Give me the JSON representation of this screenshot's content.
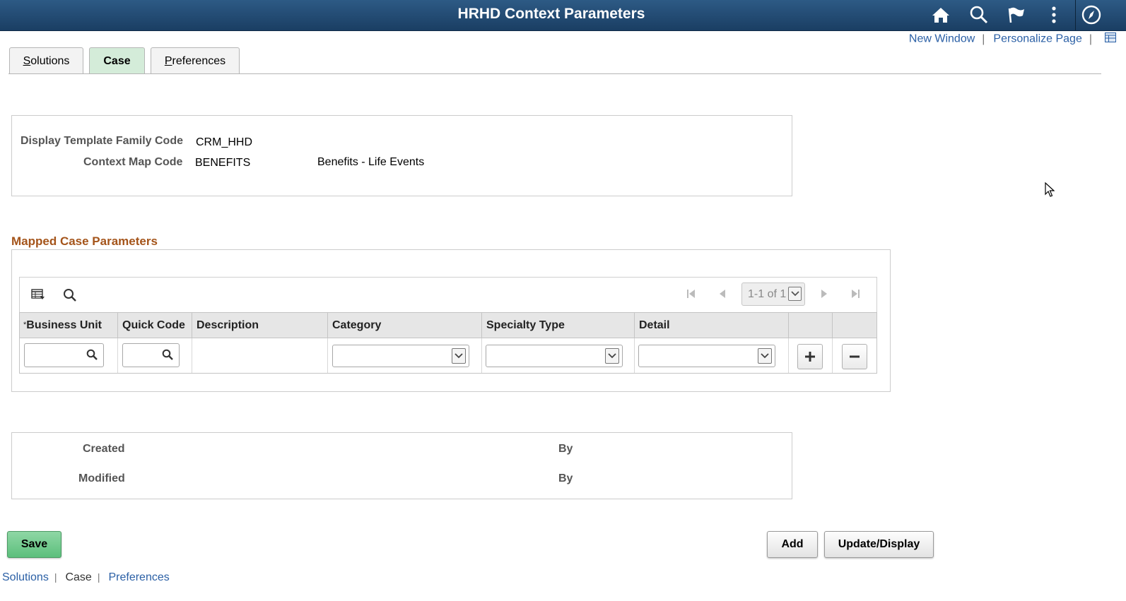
{
  "header": {
    "title": "HRHD Context Parameters",
    "icons": [
      "home-icon",
      "search-icon",
      "flag-icon",
      "more-vertical-icon",
      "navbar-compass-icon"
    ]
  },
  "toplinks": {
    "new_window": "New Window",
    "personalize_page": "Personalize Page",
    "separator": "|"
  },
  "tabs": [
    {
      "label": "Solutions",
      "access_key": "S",
      "rest": "olutions",
      "active": false
    },
    {
      "label": "Case",
      "active": true
    },
    {
      "label": "Preferences",
      "access_key": "P",
      "rest": "references",
      "active": false
    }
  ],
  "header_box": {
    "family_label": "Display Template Family Code",
    "family_value": "CRM_HHD",
    "context_label": "Context Map Code",
    "context_value": "BENEFITS",
    "context_desc": "Benefits - Life Events"
  },
  "grid": {
    "title": "Mapped Case Parameters",
    "pager": "1-1 of 1",
    "required_mark": "*",
    "columns": [
      "Business Unit",
      "Quick Code",
      "Description",
      "Category",
      "Specialty Type",
      "Detail"
    ],
    "row": {
      "business_unit": "",
      "quick_code": "",
      "description": "",
      "category": "",
      "specialty_type": "",
      "detail": ""
    }
  },
  "audit": {
    "created_label": "Created",
    "created_by_label": "By",
    "modified_label": "Modified",
    "modified_by_label": "By"
  },
  "buttons": {
    "save": "Save",
    "add": "Add",
    "update_display": "Update/Display"
  },
  "bottomlinks": {
    "solutions": "Solutions",
    "case": "Case",
    "preferences": "Preferences",
    "separator": "|"
  },
  "colors": {
    "header_bg": "#1f4a73",
    "active_tab": "#d4ecd9",
    "section_title": "#a4541a",
    "link": "#2a5fa5",
    "save_button": "#6cc68a"
  }
}
